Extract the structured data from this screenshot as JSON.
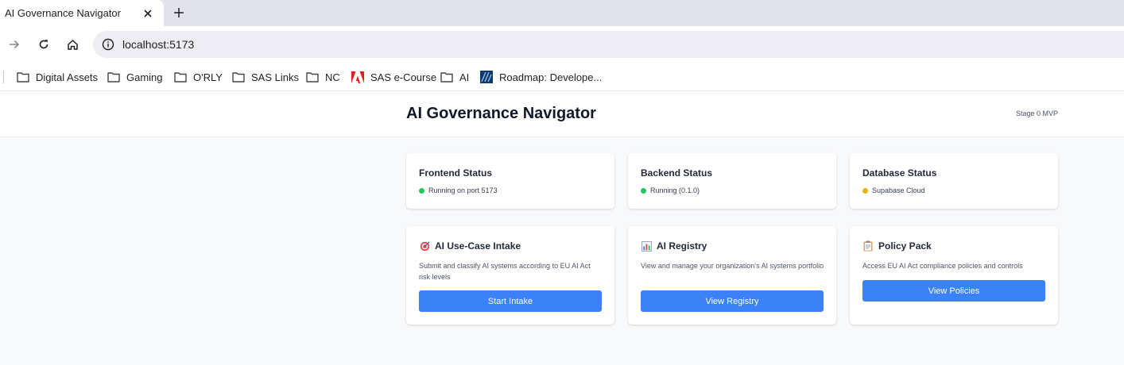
{
  "browser": {
    "tab_title": "AI Governance Navigator",
    "url": "localhost:5173",
    "bookmarks": [
      {
        "label": "Digital Assets",
        "icon": "folder-icon"
      },
      {
        "label": "Gaming",
        "icon": "folder-icon"
      },
      {
        "label": "O'RLY",
        "icon": "folder-icon"
      },
      {
        "label": "SAS Links",
        "icon": "folder-icon"
      },
      {
        "label": "NC",
        "icon": "folder-icon"
      },
      {
        "label": "SAS e-Course",
        "icon": "adobe-icon"
      },
      {
        "label": "AI",
        "icon": "folder-icon"
      },
      {
        "label": "Roadmap: Develope...",
        "icon": "roadmap-icon"
      }
    ]
  },
  "header": {
    "title": "AI Governance Navigator",
    "stage": "Stage 0 MVP"
  },
  "status": [
    {
      "title": "Frontend Status",
      "text": "Running on port 5173",
      "color": "#22c55e"
    },
    {
      "title": "Backend Status",
      "text": "Running (0.1.0)",
      "color": "#22c55e"
    },
    {
      "title": "Database Status",
      "text": "Supabase Cloud",
      "color": "#eab308"
    }
  ],
  "actions": [
    {
      "icon": "target-icon",
      "title": "AI Use-Case Intake",
      "description": "Submit and classify AI systems according to EU AI Act risk levels",
      "button": "Start Intake"
    },
    {
      "icon": "bar-chart-icon",
      "title": "AI Registry",
      "description": "View and manage your organization's AI systems portfolio",
      "button": "View Registry"
    },
    {
      "icon": "clipboard-icon",
      "title": "Policy Pack",
      "description": "Access EU AI Act compliance policies and controls",
      "button": "View Policies"
    }
  ],
  "colors": {
    "accent": "#3b82f6",
    "running": "#22c55e",
    "cloud": "#eab308"
  }
}
